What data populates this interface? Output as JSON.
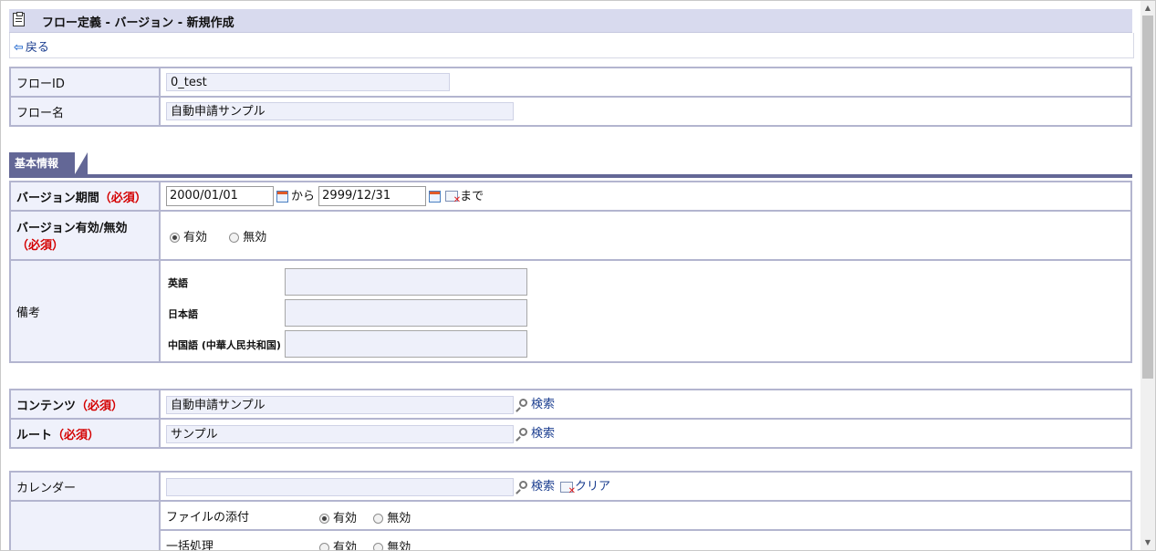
{
  "title": "フロー定義 - バージョン - 新規作成",
  "back_label": "戻る",
  "flow_id": {
    "label": "フローID",
    "value": "0_test"
  },
  "flow_name": {
    "label": "フロー名",
    "value": "自動申請サンプル"
  },
  "tab_label": "基本情報",
  "version_period": {
    "label": "バージョン期間",
    "required": "（必須）",
    "from_value": "2000/01/01",
    "kara": "から",
    "to_value": "2999/12/31",
    "made": "まで"
  },
  "version_valid": {
    "label": "バージョン有効/無効",
    "required": "（必須）",
    "option_valid": "有効",
    "option_invalid": "無効",
    "selected": "有効"
  },
  "remarks": {
    "label": "備考",
    "english": "英語",
    "japanese": "日本語",
    "chinese": "中国語 (中華人民共和国)"
  },
  "contents": {
    "label": "コンテンツ",
    "required": "（必須）",
    "value": "自動申請サンプル",
    "search": "検索"
  },
  "route": {
    "label": "ルート",
    "required": "（必須）",
    "value": "サンプル",
    "search": "検索"
  },
  "calendar": {
    "label": "カレンダー",
    "value": "",
    "search": "検索",
    "clear": "クリア"
  },
  "attachment": {
    "label": "ファイルの添付",
    "option_valid": "有効",
    "option_invalid": "無効",
    "selected": "有効"
  },
  "bulk": {
    "label": "一括処理",
    "option_valid": "有効",
    "option_invalid": "無効"
  },
  "icons": [
    "clipboard-icon",
    "back-arrow-icon",
    "calendar-icon",
    "clear-icon",
    "search-icon",
    "radio-icon"
  ]
}
